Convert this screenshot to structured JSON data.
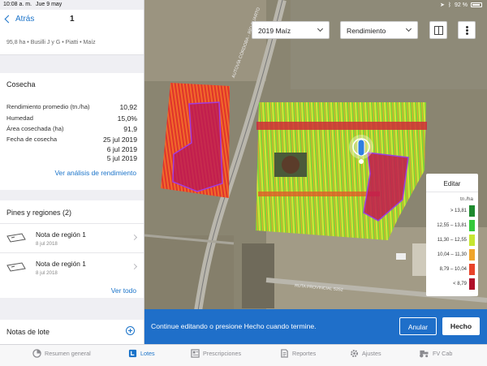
{
  "status": {
    "time": "10:08 a. m.",
    "date": "Jue 9 may",
    "battery": "92 %"
  },
  "nav": {
    "back_label": "Atrás",
    "title": "1"
  },
  "field_meta": "95,8 ha • Busilli J y G • Piatti • Maíz",
  "harvest": {
    "title": "Cosecha",
    "rows": [
      {
        "label": "Rendimiento promedio (tn./ha)",
        "value": "10,92"
      },
      {
        "label": "Humedad",
        "value": "15,0%"
      },
      {
        "label": "Área cosechada (ha)",
        "value": "91,9"
      },
      {
        "label": "Fecha de cosecha",
        "value": "25 jul 2019"
      }
    ],
    "extra_dates": [
      "6 jul 2019",
      "5 jul 2019"
    ],
    "link": "Ver análisis de rendimiento"
  },
  "pins": {
    "title": "Pines y regiones (2)",
    "items": [
      {
        "name": "Nota de región 1",
        "date": "8 jul 2018"
      },
      {
        "name": "Nota de región 1",
        "date": "8 jul 2018"
      }
    ],
    "link": "Ver todo"
  },
  "notes": {
    "title": "Notas de lote"
  },
  "map": {
    "season_select": "2019 Maíz",
    "layer_select": "Rendimiento",
    "road_label_1": "AUTOVÍA CÓRDOBA - RÍO CUARTO",
    "road_label_2": "RUTA PROVINCIAL S252"
  },
  "legend": {
    "edit": "Editar",
    "unit": "tn./ha",
    "ranges": [
      {
        "label": "> 13,81",
        "color": "#1e8a2e"
      },
      {
        "label": "12,55 – 13,81",
        "color": "#35c93a"
      },
      {
        "label": "11,30 – 12,55",
        "color": "#c6e631"
      },
      {
        "label": "10,04 – 11,30",
        "color": "#f0a52b"
      },
      {
        "label": "8,79 – 10,04",
        "color": "#e8442a"
      },
      {
        "label": "< 8,79",
        "color": "#b0102a"
      }
    ]
  },
  "banner": {
    "message": "Continue editando o presione Hecho cuando termine.",
    "cancel": "Anular",
    "done": "Hecho"
  },
  "tabs": [
    {
      "label": "Resumen general",
      "icon": "overview-icon",
      "active": false
    },
    {
      "label": "Lotes",
      "icon": "fields-icon",
      "active": true
    },
    {
      "label": "Prescripciones",
      "icon": "prescriptions-icon",
      "active": false
    },
    {
      "label": "Reportes",
      "icon": "reports-icon",
      "active": false
    },
    {
      "label": "Ajustes",
      "icon": "gear-icon",
      "active": false
    },
    {
      "label": "FV Cab",
      "icon": "tractor-icon",
      "active": false
    }
  ],
  "colors": {
    "accent": "#1a73c9",
    "banner": "#1f6fc9"
  }
}
